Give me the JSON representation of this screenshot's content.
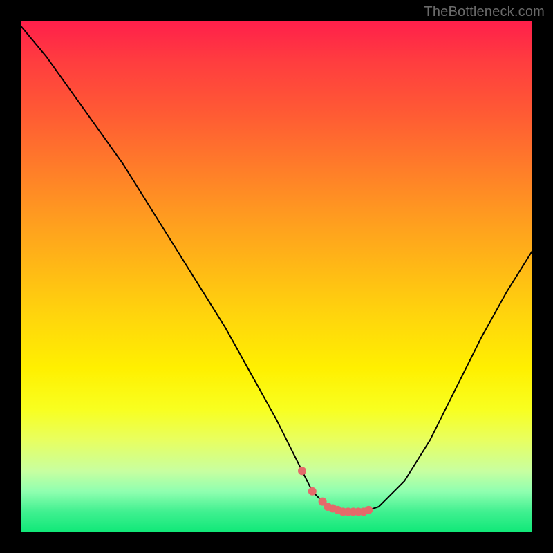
{
  "watermark": "TheBottleneck.com",
  "chart_data": {
    "type": "line",
    "title": "",
    "xlabel": "",
    "ylabel": "",
    "xlim": [
      0,
      100
    ],
    "ylim": [
      0,
      100
    ],
    "x": [
      0,
      5,
      10,
      15,
      20,
      25,
      30,
      35,
      40,
      45,
      50,
      55,
      57,
      60,
      63,
      65,
      67,
      70,
      75,
      80,
      85,
      90,
      95,
      100
    ],
    "values": [
      99,
      93,
      86,
      79,
      72,
      64,
      56,
      48,
      40,
      31,
      22,
      12,
      8,
      5,
      4,
      4,
      4,
      5,
      10,
      18,
      28,
      38,
      47,
      55
    ],
    "annotation_points_x": [
      55,
      57,
      59,
      60,
      61,
      62,
      63,
      64,
      65,
      66,
      67,
      68
    ],
    "annotation_color": "#e46a6a"
  },
  "colors": {
    "background": "#000000",
    "gradient_top": "#ff1f4b",
    "gradient_bottom": "#10e878",
    "curve": "#000000",
    "annotation": "#e46a6a",
    "watermark": "#6a6a6a"
  }
}
